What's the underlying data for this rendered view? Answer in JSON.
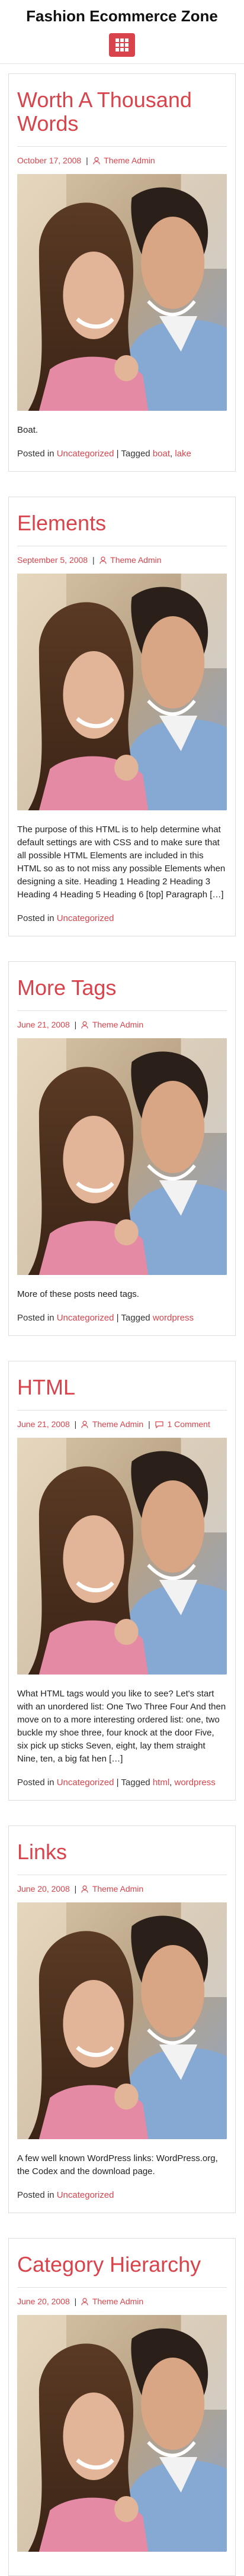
{
  "site": {
    "title": "Fashion Ecommerce Zone"
  },
  "menu": {
    "icon": "grid-menu-icon"
  },
  "posts": [
    {
      "title": "Worth A Thousand Words",
      "date": "October 17, 2008",
      "author": "Theme Admin",
      "comments": "",
      "excerpt": "Boat.",
      "posted_in_label": "Posted in",
      "category": "Uncategorized",
      "tagged_label": "| Tagged",
      "tags": [
        "boat",
        "lake"
      ]
    },
    {
      "title": "Elements",
      "date": "September 5, 2008",
      "author": "Theme Admin",
      "comments": "",
      "excerpt": "The purpose of this HTML is to help determine what default settings are with CSS and to make sure that all possible HTML Elements are included in this HTML so as to not miss any possible Elements when designing a site. Heading 1 Heading 2 Heading 3 Heading 4 Heading 5 Heading 6 [top] Paragraph […]",
      "posted_in_label": "Posted in",
      "category": "Uncategorized",
      "tagged_label": "",
      "tags": []
    },
    {
      "title": "More Tags",
      "date": "June 21, 2008",
      "author": "Theme Admin",
      "comments": "",
      "excerpt": "More of these posts need tags.",
      "posted_in_label": "Posted in",
      "category": "Uncategorized",
      "tagged_label": "| Tagged",
      "tags": [
        "wordpress"
      ]
    },
    {
      "title": "HTML",
      "date": "June 21, 2008",
      "author": "Theme Admin",
      "comments": "1 Comment",
      "excerpt": "What HTML tags would you like to see? Let's start with an unordered list: One Two Three Four And then move on to a more interesting ordered list: one, two buckle my shoe three, four knock at the door Five, six pick up sticks Seven, eight, lay them straight Nine, ten, a big fat hen […]",
      "posted_in_label": "Posted in",
      "category": "Uncategorized",
      "tagged_label": "| Tagged",
      "tags": [
        "html",
        "wordpress"
      ]
    },
    {
      "title": "Links",
      "date": "June 20, 2008",
      "author": "Theme Admin",
      "comments": "",
      "excerpt": "A few well known WordPress links: WordPress.org, the Codex and the download page.",
      "posted_in_label": "Posted in",
      "category": "Uncategorized",
      "tagged_label": "",
      "tags": []
    },
    {
      "title": "Category Hierarchy",
      "date": "June 20, 2008",
      "author": "Theme Admin",
      "comments": "",
      "excerpt": "",
      "posted_in_label": "",
      "category": "",
      "tagged_label": "",
      "tags": []
    }
  ],
  "colors": {
    "accent": "#d9434b",
    "text": "#333333",
    "border": "#dddddd"
  }
}
